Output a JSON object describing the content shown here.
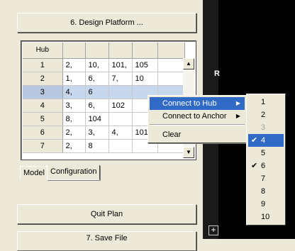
{
  "buttons": {
    "design_platform": "6.  Design Platform ...",
    "quit_plan": "Quit Plan",
    "save_file": "7.   Save File"
  },
  "grid": {
    "header_hub": "Hub",
    "rows": [
      {
        "hub": "1",
        "c1": "2,",
        "c2": "10,",
        "c3": "101,",
        "c4": "105"
      },
      {
        "hub": "2",
        "c1": "1,",
        "c2": "6,",
        "c3": "7,",
        "c4": "10"
      },
      {
        "hub": "3",
        "c1": "4,",
        "c2": "6",
        "c3": "",
        "c4": ""
      },
      {
        "hub": "4",
        "c1": "3,",
        "c2": "6,",
        "c3": "102",
        "c4": ""
      },
      {
        "hub": "5",
        "c1": "8,",
        "c2": "104",
        "c3": "",
        "c4": ""
      },
      {
        "hub": "6",
        "c1": "2,",
        "c2": "3,",
        "c3": "4,",
        "c4": "101"
      },
      {
        "hub": "7",
        "c1": "2,",
        "c2": "8",
        "c3": "",
        "c4": ""
      }
    ],
    "selected_row": "3"
  },
  "tabs": {
    "model": "Model",
    "configuration": "Configuration"
  },
  "viewport": {
    "label": "R"
  },
  "context_menu": {
    "connect_hub": "Connect to Hub",
    "connect_anchor": "Connect to Anchor",
    "clear": "Clear"
  },
  "submenu": {
    "items": [
      "1",
      "2",
      "3",
      "4",
      "5",
      "6",
      "7",
      "8",
      "9",
      "10"
    ],
    "checked": [
      "4",
      "6"
    ],
    "disabled": [
      "3"
    ],
    "highlighted": "4"
  },
  "colors": {
    "highlight": "#316ac5",
    "panel": "#ece9d8"
  }
}
